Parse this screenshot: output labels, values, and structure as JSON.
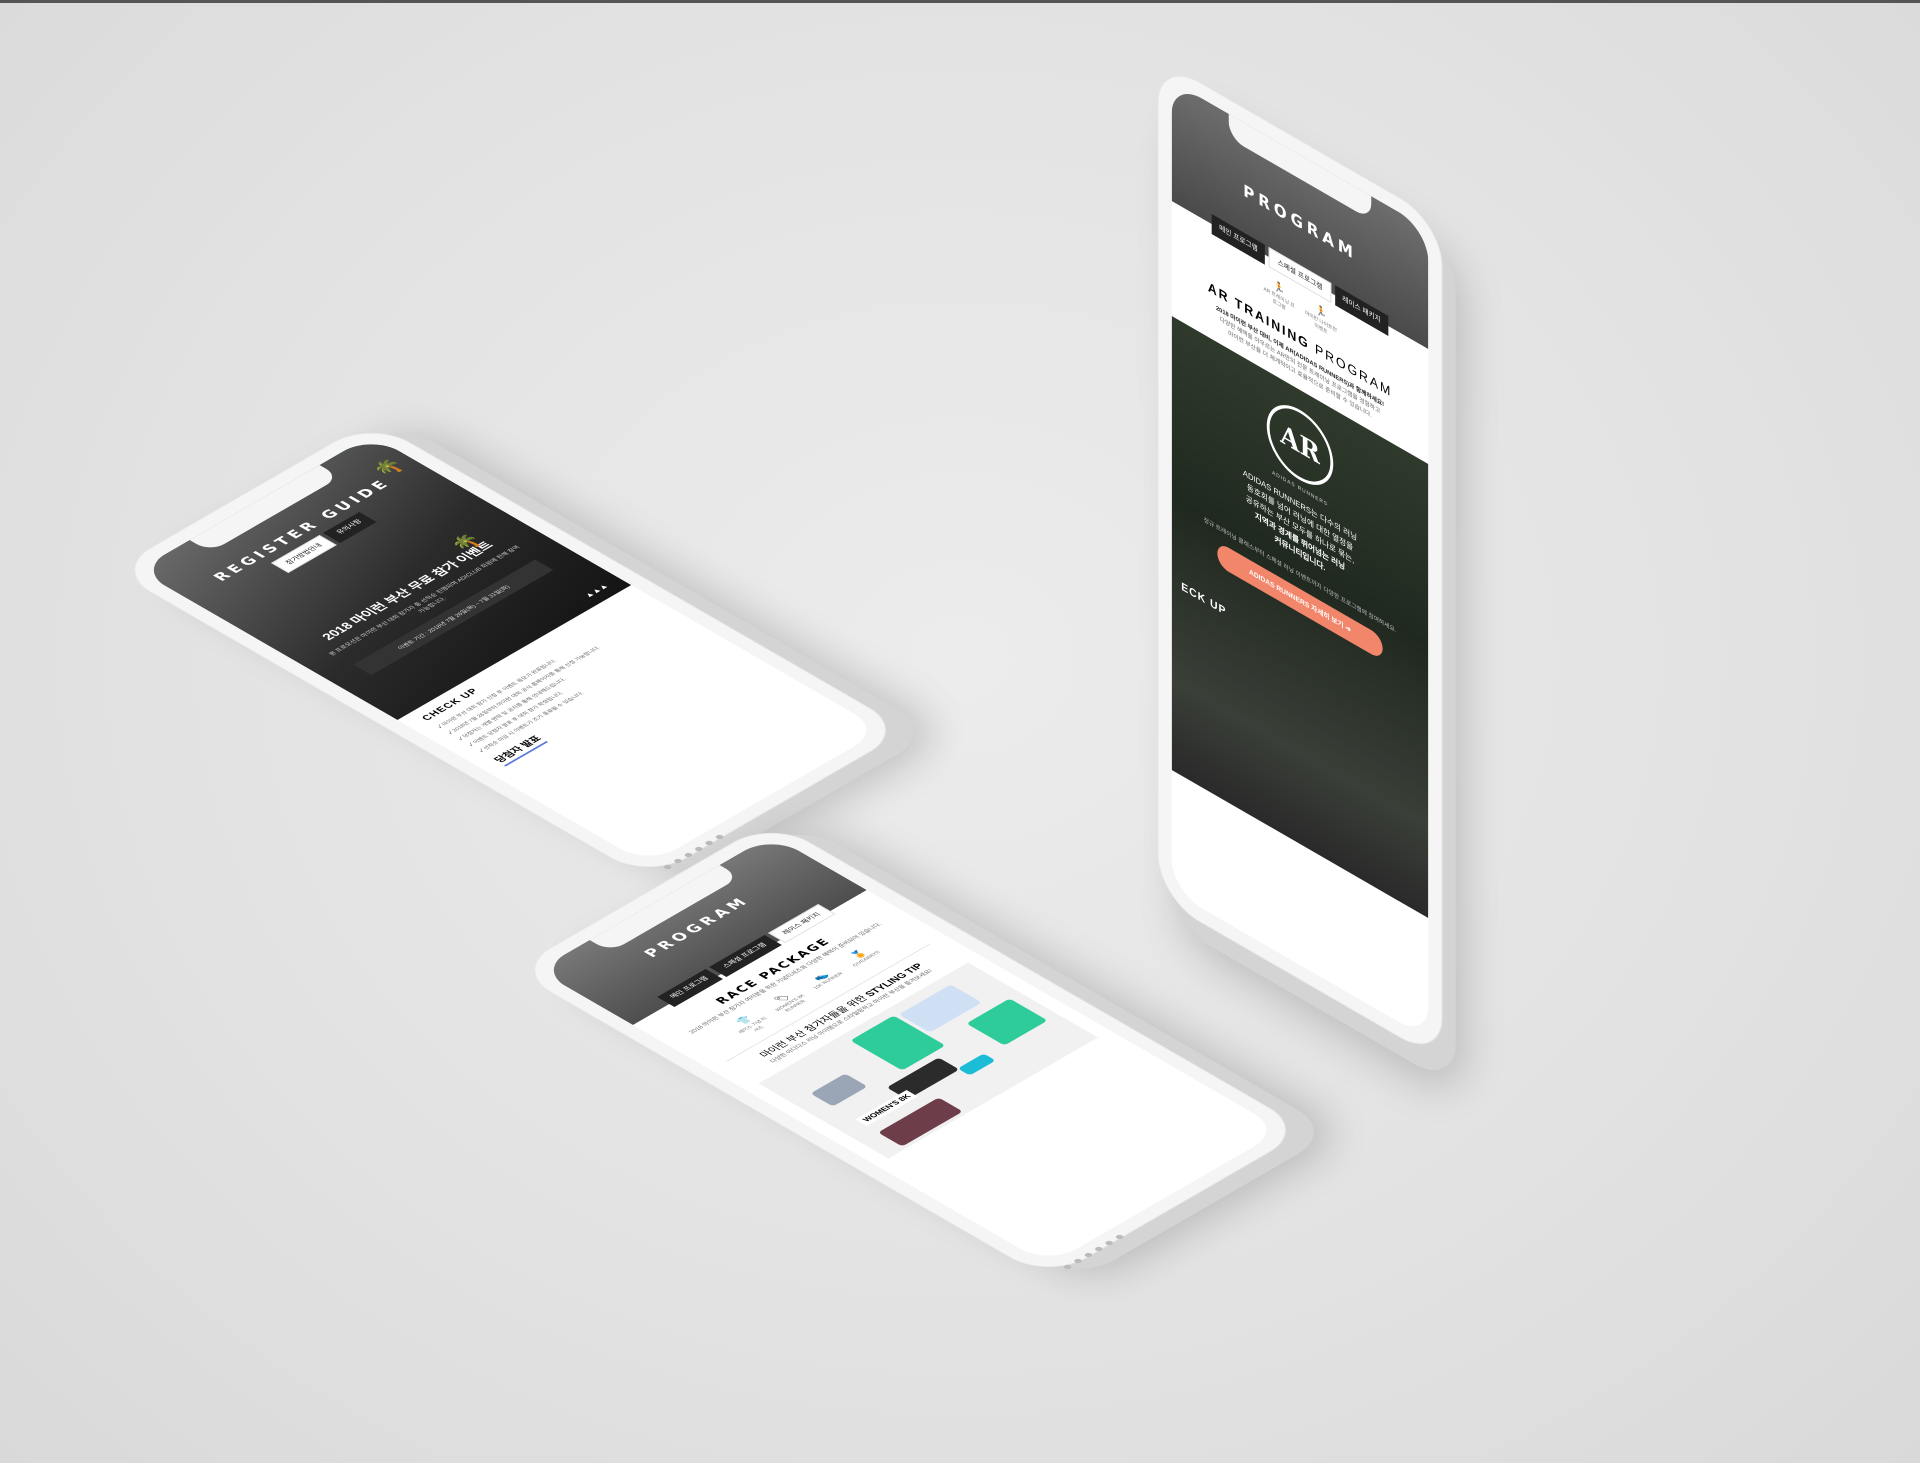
{
  "phone1": {
    "header_title": "REGISTER GUIDE",
    "tabs": [
      "참가방법안내",
      "유의사항"
    ],
    "event_title": "2018 마이런 부산 무료 참가 이벤트",
    "event_desc": "본 프로모션은 마이런 부산 대회 참가자 중 선착순 진행되며 ADICLUB 회원에 한해 참여 가능합니다.",
    "event_period": "이벤트 기간 : 2018년 7월 26일(목) ~ 7월 31일(화)",
    "check_title": "CHECK UP",
    "checklist": [
      "마이런 부산 대회 참가 신청 후 이벤트 응모가 완료됩니다.",
      "2018년 7월 26일부터 마이런 대회 공식 홈페이지를 통해 신청 가능합니다.",
      "당첨자는 개별 연락 및 공지를 통해 안내해드립니다.",
      "이벤트 당첨자 발표 후 대회 참가 확정됩니다.",
      "선착순 마감 시 이벤트가 조기 종료될 수 있습니다."
    ],
    "winner_title": "당첨자 발표"
  },
  "phone2": {
    "header_title": "PROGRAM",
    "tabs": [
      "메인 프로그램",
      "스페셜 프로그램",
      "레이스 패키지"
    ],
    "subtabs": [
      "AR 트레이닝 프로그램",
      "마이런 나이트런 이벤트"
    ],
    "section_title_bold": "AR TRAINING",
    "section_title_light": "PROGRAM",
    "intro_line1": "2018 마이런 부산 대비, 이제 AR(ADIDAS RUNNERS)과 함께하세요!",
    "intro_line2": "다양한 혜택을 아우르는 AR만의 전문 트레이닝 프로그램을 경험하고",
    "intro_line3": "마이런 부산을 더 체계적이고 효율적으로 준비할 수 있습니다.",
    "logo_text": "AR",
    "logo_ring": "ADIDAS RUNNERS",
    "ar_desc1": "ADIDAS RUNNERS는 다수의 러닝",
    "ar_desc2": "동호회를 넘어 러닝에 대한 열정을",
    "ar_desc3": "공유하는 부산 모두를 하나로 묶는,",
    "ar_desc_bold1": "지역과 경계를 뛰어넘는 러닝",
    "ar_desc_bold2": "커뮤니티입니다.",
    "ar_note": "정규 트레이닝 클래스부터 스페셜 러닝 이벤트까지 다양한 프로그램에 참여하세요.",
    "cta_button": "ADIDAS RUNNERS 자세히 보기 ➜",
    "check_title": "ECK UP"
  },
  "phone3": {
    "header_title": "PROGRAM",
    "tabs": [
      "메인 프로그램",
      "스페셜 프로그램",
      "레이스 패키지"
    ],
    "section_title": "RACE PACKAGE",
    "intro": "2018 마이런 부산 참가자 여러분을 위한 기념티셔츠와 다양한 혜택이 준비되어 있습니다.",
    "package_items": [
      {
        "icon": "shirt-icon",
        "label": "레이스 기념 티셔츠"
      },
      {
        "icon": "bib-icon",
        "label": "WOMEN'S 8K RUNNER"
      },
      {
        "icon": "shoe-icon",
        "label": "10K RUNNER"
      },
      {
        "icon": "medal-icon",
        "label": "GIVEAWAYS"
      }
    ],
    "styling_prefix": "마이런 부산 참가자들을 위한",
    "styling_bold": "STYLING TIP",
    "styling_desc": "다양한 아디다스 러닝 아이템으로 스타일링하고 마이런 부산을 즐겨보세요!",
    "product_badge": "WOMEN'S 8K"
  },
  "colors": {
    "accent_green": "#26c79a",
    "cta_orange": "#f2866b",
    "dark": "#1a1a1a"
  }
}
